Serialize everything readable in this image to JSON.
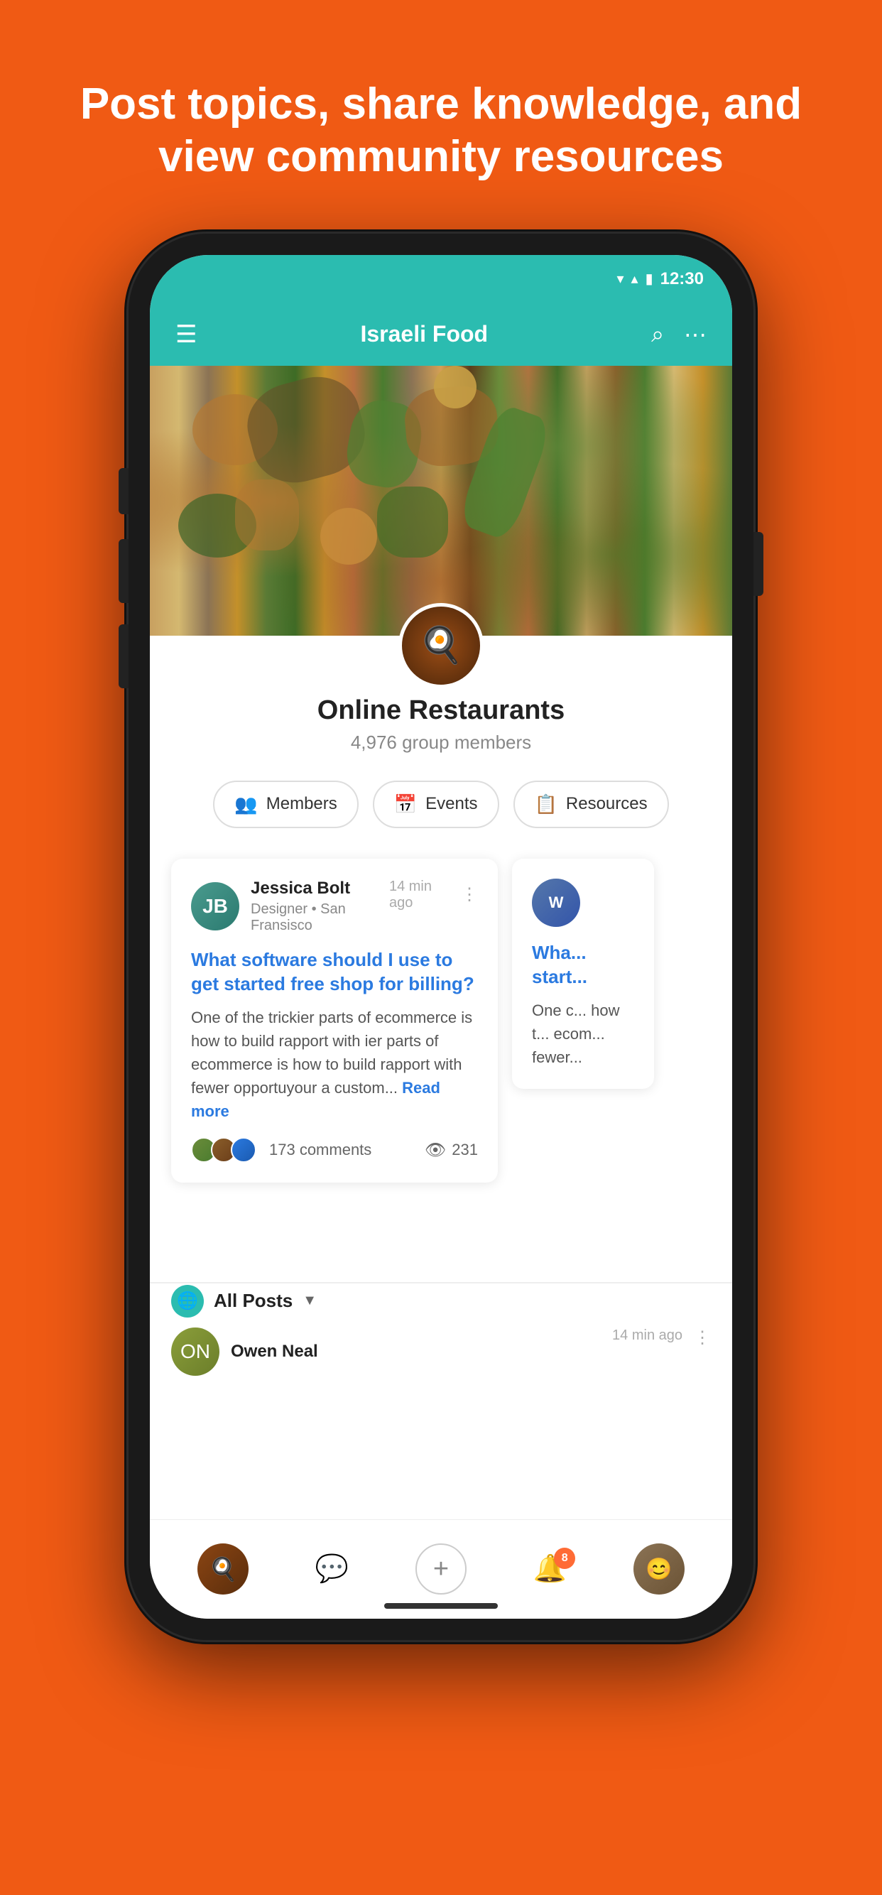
{
  "headline": "Post topics, share knowledge, and view community resources",
  "status_bar": {
    "time": "12:30",
    "wifi": "▲",
    "signal": "▲",
    "battery": "🔋"
  },
  "app_bar": {
    "menu_label": "☰",
    "title": "Israeli Food",
    "search_label": "🔍",
    "more_label": "⋯"
  },
  "group": {
    "name": "Online Restaurants",
    "members": "4,976 group members",
    "avatar_emoji": "🍳"
  },
  "action_buttons": [
    {
      "icon": "👥",
      "label": "Members"
    },
    {
      "icon": "📅",
      "label": "Events"
    },
    {
      "icon": "📋",
      "label": "Resources"
    }
  ],
  "featured_post": {
    "username": "Jessica Bolt",
    "subtitle": "Designer • San Fransisco",
    "time": "14 min ago",
    "title": "What software should I use to get started free shop for billing?",
    "body": "One of the trickier parts of ecommerce is how to build rapport with ier parts of ecommerce is how to build rapport with fewer opportuyour a custom...",
    "read_more": "Read more",
    "comments": "173 comments",
    "views": "231"
  },
  "partial_post": {
    "username": "Wha...",
    "subtitle": "start...",
    "body": "One c... how t... ecom... fewer..."
  },
  "all_posts_filter": {
    "label": "All Posts",
    "caret": "▼"
  },
  "bottom_post": {
    "username": "Owen Neal",
    "time": "14 min ago"
  },
  "bottom_nav": {
    "notification_badge": "8",
    "items": [
      {
        "id": "home",
        "label": "home"
      },
      {
        "id": "chat",
        "label": "chat"
      },
      {
        "id": "add",
        "label": "add"
      },
      {
        "id": "bell",
        "label": "notifications"
      },
      {
        "id": "profile",
        "label": "profile"
      }
    ]
  }
}
